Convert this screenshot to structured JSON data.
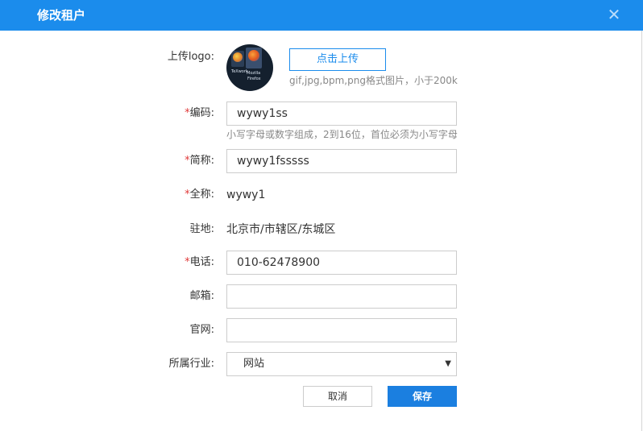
{
  "dialog": {
    "title": "修改租户",
    "close_glyph": "✕"
  },
  "logo": {
    "label": "上传logo:",
    "upload_label": "点击上传",
    "hint": "gif,jpg,bpm,png格式图片，小于200k",
    "avatar_captions": [
      "TeXwork",
      "Mozilla",
      "Firefox"
    ]
  },
  "form": {
    "required_mark": "*",
    "code": {
      "label": "编码:",
      "value": "wywy1ss",
      "hint": "小写字母或数字组成，2到16位，首位必须为小写字母"
    },
    "short_name": {
      "label": "简称:",
      "value": "wywy1fsssss"
    },
    "full_name": {
      "label": "全称:",
      "value": "wywy1"
    },
    "location": {
      "label": "驻地:",
      "value": "北京市/市辖区/东城区"
    },
    "phone": {
      "label": "电话:",
      "value": "010-62478900"
    },
    "email": {
      "label": "邮箱:",
      "value": ""
    },
    "website": {
      "label": "官网:",
      "value": ""
    },
    "industry": {
      "label": "所属行业:",
      "value": "网站",
      "arrow": "▼"
    }
  },
  "buttons": {
    "cancel": "取消",
    "save": "保存"
  },
  "colors": {
    "header": "#1b8cec",
    "primary_button": "#1b7fe0",
    "required": "#e03a3a"
  }
}
